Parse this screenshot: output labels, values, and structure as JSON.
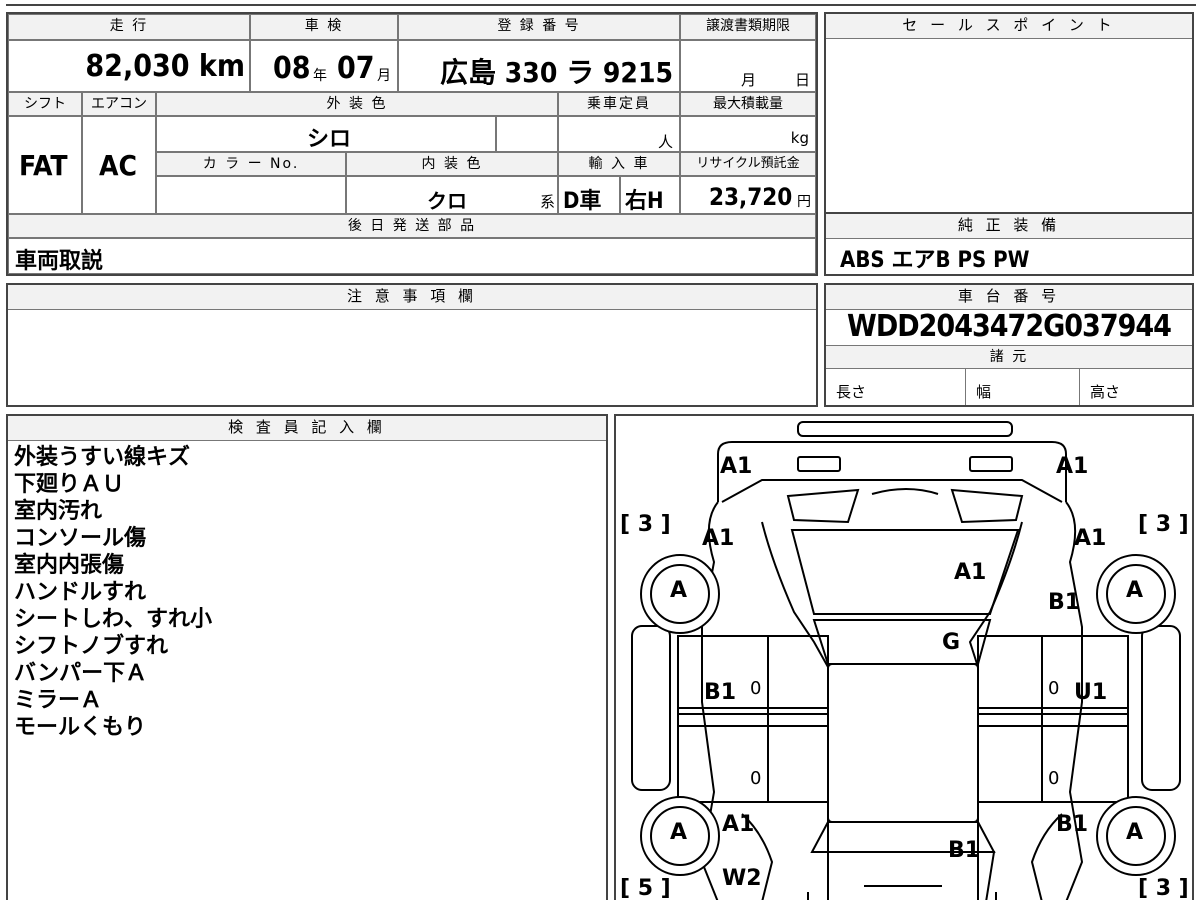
{
  "vehicle": {
    "mileage_label": "走 行",
    "mileage_value": "82,030 km",
    "inspection_label": "車 検",
    "inspection_year": "08",
    "inspection_year_unit": "年",
    "inspection_month": "07",
    "inspection_month_unit": "月",
    "registration_label": "登 録 番 号",
    "registration_value": "広島 330 ラ 9215",
    "transfer_label": "譲渡書類期限",
    "transfer_month_unit": "月",
    "transfer_day_unit": "日",
    "shift_label": "シフト",
    "shift_value": "FAT",
    "ac_label": "エアコン",
    "ac_value": "AC",
    "exterior_label": "外 装 色",
    "exterior_value": "シロ",
    "color_no_label": "カ ラ ー No.",
    "interior_label": "内 装 色",
    "interior_value": "クロ",
    "interior_suffix": "系",
    "capacity_label": "乗車定員",
    "capacity_unit": "人",
    "max_load_label": "最大積載量",
    "max_load_unit": "kg",
    "import_label": "輸 入 車",
    "import_value_1": "D車",
    "import_value_2": "右H",
    "recycle_label": "リサイクル預託金",
    "recycle_value": "23,720",
    "recycle_unit": "円"
  },
  "sales_point": {
    "title": "セ ー ル ス ポ イ ン ト"
  },
  "later_parts": {
    "title": "後 日 発 送 部 品",
    "value": "車両取説"
  },
  "genuine_equipment": {
    "title": "純 正 装 備",
    "value": "ABS エアB PS PW"
  },
  "notes": {
    "title": "注 意 事 項 欄"
  },
  "chassis": {
    "title": "車 台 番 号",
    "value": "WDD2043472G037944",
    "specs_title": "諸 元",
    "length_label": "長さ",
    "width_label": "幅",
    "height_label": "高さ"
  },
  "inspector": {
    "title": "検 査 員 記 入 欄",
    "lines": [
      "外装うすい線キズ",
      "下廻りＡＵ",
      "室内汚れ",
      "コンソール傷",
      "室内内張傷",
      "ハンドルすれ",
      "シートしわ、すれ小",
      "シフトノブすれ",
      "バンパー下Ａ",
      "ミラーＡ",
      "モールくもり"
    ]
  },
  "diagram": {
    "marks": {
      "front_left": "A1",
      "front_right": "A1",
      "fender_fl": "A1",
      "fender_fr": "A1",
      "windshield": "A1",
      "hood_right": "B1",
      "roof": "G",
      "door_left": "B1",
      "door_right": "U1",
      "zero_1": "0",
      "zero_2": "0",
      "zero_3": "0",
      "zero_4": "0",
      "rear_left": "A1",
      "rear_right": "B1",
      "trunk": "B1",
      "rear_bottom_left": "W2",
      "wheel_fl": "A",
      "wheel_fr": "A",
      "wheel_rl": "A",
      "wheel_rr": "A"
    },
    "brackets": {
      "fl": "[ 3 ]",
      "fr": "[ 3 ]",
      "rl": "[ 5 ]",
      "rr": "[ 3 ]"
    }
  }
}
